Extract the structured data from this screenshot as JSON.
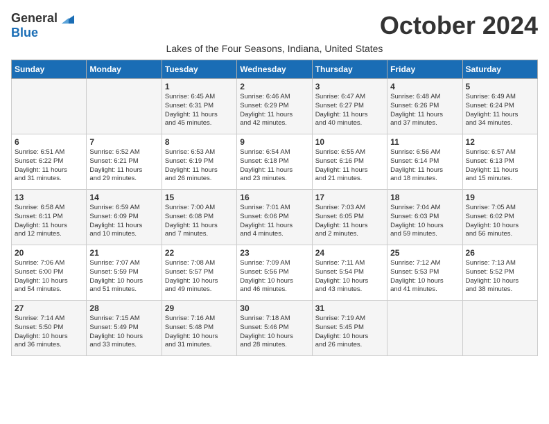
{
  "logo": {
    "general": "General",
    "blue": "Blue"
  },
  "title": "October 2024",
  "subtitle": "Lakes of the Four Seasons, Indiana, United States",
  "days_of_week": [
    "Sunday",
    "Monday",
    "Tuesday",
    "Wednesday",
    "Thursday",
    "Friday",
    "Saturday"
  ],
  "weeks": [
    [
      {
        "day": "",
        "content": ""
      },
      {
        "day": "",
        "content": ""
      },
      {
        "day": "1",
        "content": "Sunrise: 6:45 AM\nSunset: 6:31 PM\nDaylight: 11 hours\nand 45 minutes."
      },
      {
        "day": "2",
        "content": "Sunrise: 6:46 AM\nSunset: 6:29 PM\nDaylight: 11 hours\nand 42 minutes."
      },
      {
        "day": "3",
        "content": "Sunrise: 6:47 AM\nSunset: 6:27 PM\nDaylight: 11 hours\nand 40 minutes."
      },
      {
        "day": "4",
        "content": "Sunrise: 6:48 AM\nSunset: 6:26 PM\nDaylight: 11 hours\nand 37 minutes."
      },
      {
        "day": "5",
        "content": "Sunrise: 6:49 AM\nSunset: 6:24 PM\nDaylight: 11 hours\nand 34 minutes."
      }
    ],
    [
      {
        "day": "6",
        "content": "Sunrise: 6:51 AM\nSunset: 6:22 PM\nDaylight: 11 hours\nand 31 minutes."
      },
      {
        "day": "7",
        "content": "Sunrise: 6:52 AM\nSunset: 6:21 PM\nDaylight: 11 hours\nand 29 minutes."
      },
      {
        "day": "8",
        "content": "Sunrise: 6:53 AM\nSunset: 6:19 PM\nDaylight: 11 hours\nand 26 minutes."
      },
      {
        "day": "9",
        "content": "Sunrise: 6:54 AM\nSunset: 6:18 PM\nDaylight: 11 hours\nand 23 minutes."
      },
      {
        "day": "10",
        "content": "Sunrise: 6:55 AM\nSunset: 6:16 PM\nDaylight: 11 hours\nand 21 minutes."
      },
      {
        "day": "11",
        "content": "Sunrise: 6:56 AM\nSunset: 6:14 PM\nDaylight: 11 hours\nand 18 minutes."
      },
      {
        "day": "12",
        "content": "Sunrise: 6:57 AM\nSunset: 6:13 PM\nDaylight: 11 hours\nand 15 minutes."
      }
    ],
    [
      {
        "day": "13",
        "content": "Sunrise: 6:58 AM\nSunset: 6:11 PM\nDaylight: 11 hours\nand 12 minutes."
      },
      {
        "day": "14",
        "content": "Sunrise: 6:59 AM\nSunset: 6:09 PM\nDaylight: 11 hours\nand 10 minutes."
      },
      {
        "day": "15",
        "content": "Sunrise: 7:00 AM\nSunset: 6:08 PM\nDaylight: 11 hours\nand 7 minutes."
      },
      {
        "day": "16",
        "content": "Sunrise: 7:01 AM\nSunset: 6:06 PM\nDaylight: 11 hours\nand 4 minutes."
      },
      {
        "day": "17",
        "content": "Sunrise: 7:03 AM\nSunset: 6:05 PM\nDaylight: 11 hours\nand 2 minutes."
      },
      {
        "day": "18",
        "content": "Sunrise: 7:04 AM\nSunset: 6:03 PM\nDaylight: 10 hours\nand 59 minutes."
      },
      {
        "day": "19",
        "content": "Sunrise: 7:05 AM\nSunset: 6:02 PM\nDaylight: 10 hours\nand 56 minutes."
      }
    ],
    [
      {
        "day": "20",
        "content": "Sunrise: 7:06 AM\nSunset: 6:00 PM\nDaylight: 10 hours\nand 54 minutes."
      },
      {
        "day": "21",
        "content": "Sunrise: 7:07 AM\nSunset: 5:59 PM\nDaylight: 10 hours\nand 51 minutes."
      },
      {
        "day": "22",
        "content": "Sunrise: 7:08 AM\nSunset: 5:57 PM\nDaylight: 10 hours\nand 49 minutes."
      },
      {
        "day": "23",
        "content": "Sunrise: 7:09 AM\nSunset: 5:56 PM\nDaylight: 10 hours\nand 46 minutes."
      },
      {
        "day": "24",
        "content": "Sunrise: 7:11 AM\nSunset: 5:54 PM\nDaylight: 10 hours\nand 43 minutes."
      },
      {
        "day": "25",
        "content": "Sunrise: 7:12 AM\nSunset: 5:53 PM\nDaylight: 10 hours\nand 41 minutes."
      },
      {
        "day": "26",
        "content": "Sunrise: 7:13 AM\nSunset: 5:52 PM\nDaylight: 10 hours\nand 38 minutes."
      }
    ],
    [
      {
        "day": "27",
        "content": "Sunrise: 7:14 AM\nSunset: 5:50 PM\nDaylight: 10 hours\nand 36 minutes."
      },
      {
        "day": "28",
        "content": "Sunrise: 7:15 AM\nSunset: 5:49 PM\nDaylight: 10 hours\nand 33 minutes."
      },
      {
        "day": "29",
        "content": "Sunrise: 7:16 AM\nSunset: 5:48 PM\nDaylight: 10 hours\nand 31 minutes."
      },
      {
        "day": "30",
        "content": "Sunrise: 7:18 AM\nSunset: 5:46 PM\nDaylight: 10 hours\nand 28 minutes."
      },
      {
        "day": "31",
        "content": "Sunrise: 7:19 AM\nSunset: 5:45 PM\nDaylight: 10 hours\nand 26 minutes."
      },
      {
        "day": "",
        "content": ""
      },
      {
        "day": "",
        "content": ""
      }
    ]
  ]
}
